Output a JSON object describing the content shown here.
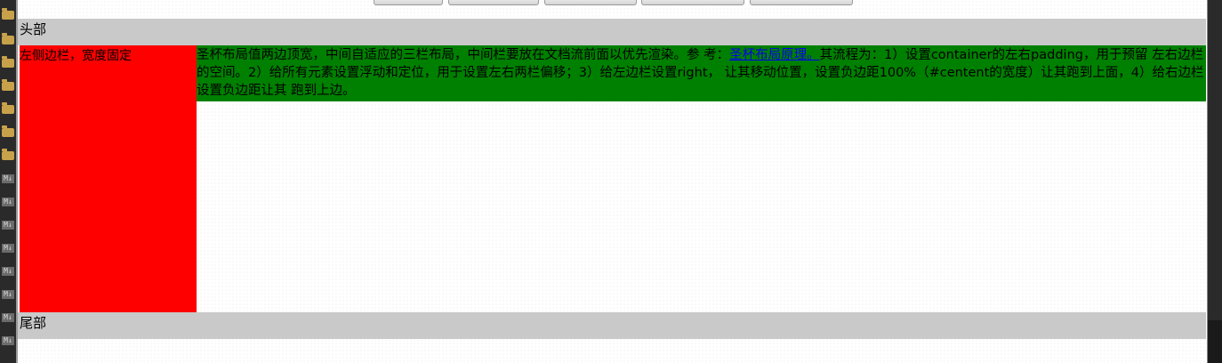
{
  "header": {
    "label": "头部"
  },
  "left_sidebar": {
    "label": "左侧边栏，宽度固定"
  },
  "center": {
    "text_before_link": "圣杯布局值两边顶宽，中间自适应的三栏布局，中间栏要放在文档流前面以优先渲染。参 考：",
    "link_text": "圣杯布局原理。",
    "text_after_link": "其流程为：1）设置container的左右padding，用于预留 左右边栏的空间。2）给所有元素设置浮动和定位，用于设置左右两栏偏移；3）给左边栏设置right， 让其移动位置，设置负边距100%（#centent的宽度）让其跑到上面，4）给右边栏设置负边距让其 跑到上边。"
  },
  "footer": {
    "label": "尾部"
  },
  "colors": {
    "header_bg": "#c9c9c9",
    "left_bg": "#ff0000",
    "center_bg": "#008000",
    "link": "#0000ee"
  },
  "icons": [
    "folder-icon",
    "markdown-file-icon"
  ]
}
